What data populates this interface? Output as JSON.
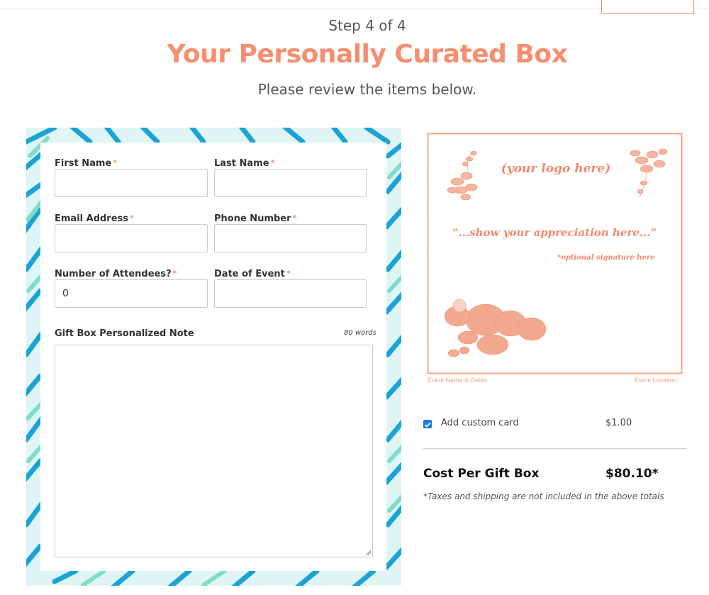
{
  "header": {
    "step": "Step 4 of 4",
    "title": "Your Personally Curated Box",
    "subtitle": "Please review the items below."
  },
  "form": {
    "first_name": {
      "label": "First Name",
      "required": "*",
      "value": ""
    },
    "last_name": {
      "label": "Last Name",
      "required": "*",
      "value": ""
    },
    "email": {
      "label": "Email Address",
      "required": "*",
      "value": ""
    },
    "phone": {
      "label": "Phone Number",
      "required": "*",
      "value": ""
    },
    "attendees": {
      "label": "Number of Attendees?",
      "required": "*",
      "value": "0"
    },
    "event_date": {
      "label": "Date of Event",
      "required": "*",
      "value": ""
    },
    "note": {
      "label": "Gift Box Personalized Note",
      "limit": "80 words",
      "value": ""
    }
  },
  "card_preview": {
    "logo": "(your logo here)",
    "message": "“...show your appreciation here...”",
    "signature": "*optional signature here",
    "footer_left": "Event Name & Dates",
    "footer_right": "Event Location"
  },
  "options": {
    "custom_card": {
      "label": "Add custom card",
      "price": "$1.00",
      "checked": true
    }
  },
  "totals": {
    "label": "Cost Per Gift Box",
    "value": "$80.10*",
    "note": "*Taxes and shipping are not included in the above totals"
  },
  "colors": {
    "accent": "#f58f6f",
    "checkbox": "#1f7ae0",
    "leaf_blue": "#1aa3d4",
    "leaf_teal": "#7fdcc8"
  }
}
